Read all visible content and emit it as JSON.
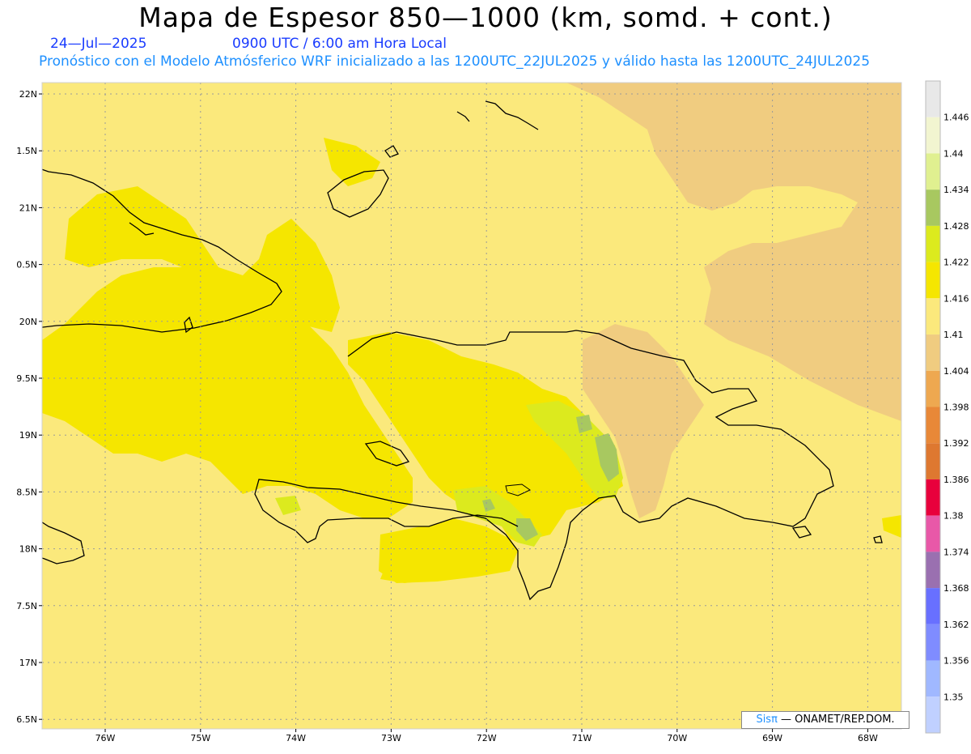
{
  "header": {
    "title": "Mapa de Espesor 850—1000 (km, somd. + cont.)",
    "date": "24—Jul—2025",
    "time": "0900 UTC / 6:00 am Hora Local",
    "forecast_line": "Pronóstico con el Modelo Atmósferico WRF inicializado a las 1200UTC_22JUL2025 y válido hasta las  1200UTC_24JUL2025"
  },
  "axes": {
    "lat_labels": [
      "22N",
      "1.5N",
      "21N",
      "0.5N",
      "20N",
      "9.5N",
      "19N",
      "8.5N",
      "18N",
      "7.5N",
      "17N",
      "6.5N"
    ],
    "lon_labels": [
      "76W",
      "75W",
      "74W",
      "73W",
      "72W",
      "71W",
      "70W",
      "69W",
      "68W"
    ]
  },
  "colorbar": {
    "labels": [
      "1.446",
      "1.44",
      "1.434",
      "1.428",
      "1.422",
      "1.416",
      "1.41",
      "1.404",
      "1.398",
      "1.392",
      "1.386",
      "1.38",
      "1.374",
      "1.368",
      "1.362",
      "1.356",
      "1.35"
    ],
    "colors": [
      "#e8e8e8",
      "#f2f5d0",
      "#e0f090",
      "#a8c860",
      "#dcea1e",
      "#f5e600",
      "#fbe97c",
      "#f0cc80",
      "#eea850",
      "#e88838",
      "#de7830",
      "#e8003c",
      "#e858a8",
      "#9a70b0",
      "#6870ff",
      "#7f8cff",
      "#a0b8ff",
      "#c0d0ff"
    ]
  },
  "map_colors": {
    "background": "#fbe97c",
    "warm_region": "#f0cc80",
    "yellow_region": "#f5e600",
    "green_region": "#dcea1e",
    "dark_green": "#a8c860"
  },
  "credit": {
    "brand": "Sisπ",
    "text": " — ONAMET/REP.DOM."
  }
}
